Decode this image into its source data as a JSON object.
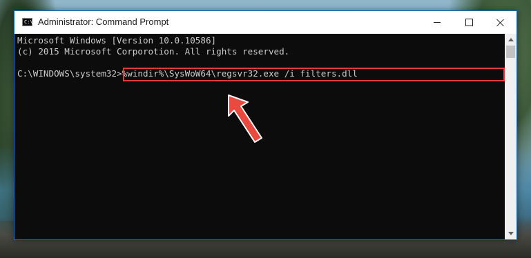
{
  "window": {
    "title": "Administrator: Command Prompt",
    "icon": "cmd-icon",
    "icon_glyph": "C:\\",
    "controls": [
      "minimize-icon",
      "maximize-icon",
      "close-icon"
    ]
  },
  "console": {
    "lines": [
      "Microsoft Windows [Version 10.0.10586]",
      "(c) 2015 Microsoft Corporotion. All rights reserved."
    ],
    "prompt": "C:\\WINDOWS\\system32>",
    "command": "%windir%\\SysWoW64\\regsvr32.exe /i filters.dll"
  },
  "annotation": {
    "highlight_color": "#e03a3a",
    "arrow_color": "#e84a3f"
  },
  "colors": {
    "console_bg": "#0c0c0c",
    "console_text": "#cccccc",
    "window_border": "#1b6bb3"
  }
}
